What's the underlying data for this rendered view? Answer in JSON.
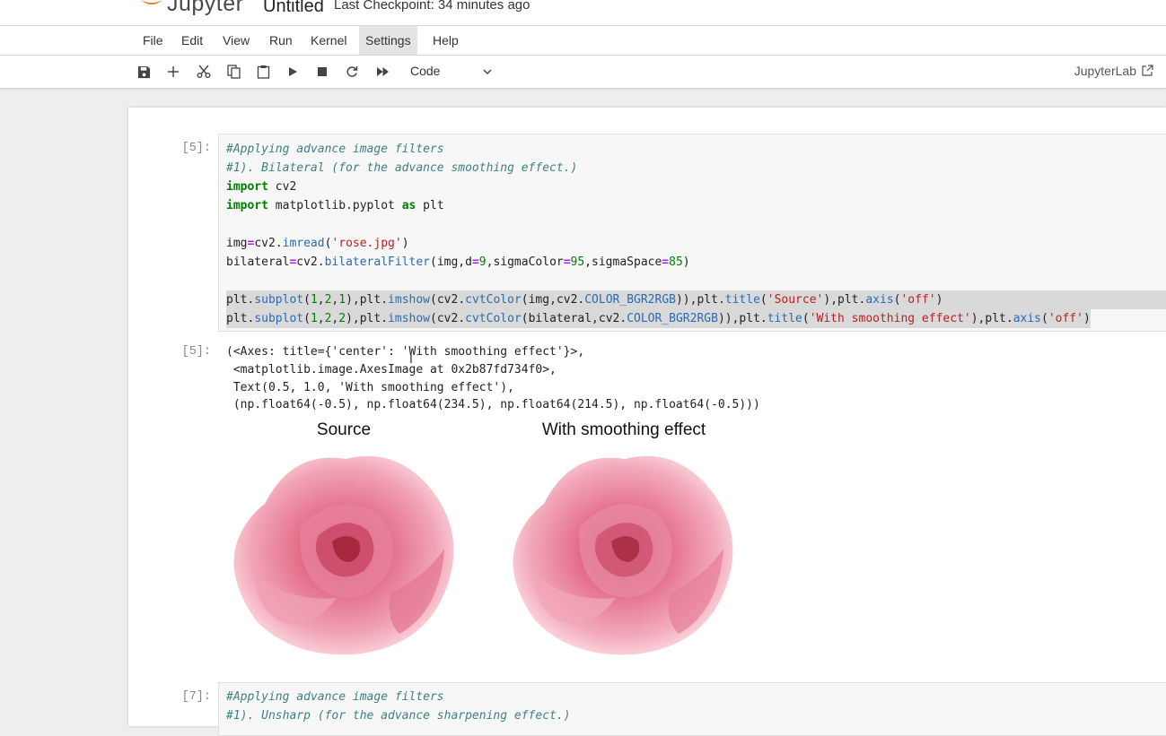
{
  "header": {
    "logo_text": "Jupyter",
    "notebook_title": "Untitled",
    "checkpoint": "Last Checkpoint: 34 minutes ago"
  },
  "menu": [
    "File",
    "Edit",
    "View",
    "Run",
    "Kernel",
    "Settings",
    "Help"
  ],
  "menu_active": "Settings",
  "toolbar": {
    "cell_type": "Code",
    "jupyterlab_link": "JupyterLab",
    "icons": [
      "save-icon",
      "plus-icon",
      "scissors-icon",
      "copy-icon",
      "paste-icon",
      "play-icon",
      "stop-icon",
      "restart-icon",
      "fast-forward-icon",
      "chevron-down-icon",
      "external-link-icon"
    ]
  },
  "cell1": {
    "in_prompt": "[5]:",
    "out_prompt": "[5]:",
    "code": [
      "#Applying advance image filters",
      "#1). Bilateral (for the advance smoothing effect.)",
      "import cv2",
      "import matplotlib.pyplot as plt",
      "",
      "img=cv2.imread('rose.jpg')",
      "bilateral=cv2.bilateralFilter(img,d=9,sigmaColor=95,sigmaSpace=85)",
      "",
      "plt.subplot(1,2,1),plt.imshow(cv2.cvtColor(img,cv2.COLOR_BGR2RGB)),plt.title('Source'),plt.axis('off')",
      "plt.subplot(1,2,2),plt.imshow(cv2.cvtColor(bilateral,cv2.COLOR_BGR2RGB)),plt.title('With smoothing effect'),plt.axis('off')"
    ],
    "output": [
      "(<Axes: title={'center': 'With smoothing effect'}>,",
      " <matplotlib.image.AxesImage at 0x2b87fd734f0>,",
      " Text(0.5, 1.0, 'With smoothing effect'),",
      " (np.float64(-0.5), np.float64(234.5), np.float64(214.5), np.float64(-0.5)))"
    ],
    "figure_titles": [
      "Source",
      "With smoothing effect"
    ]
  },
  "cell2": {
    "in_prompt": "[7]:",
    "code": [
      "#Applying advance image filters",
      "#1). Unsharp (for the advance sharpening effect.)"
    ]
  },
  "colors": {
    "accent_orange": "#f37726",
    "comment": "#408080",
    "keyword": "#008000",
    "string": "#ba2121",
    "function": "#2a6bb3",
    "rose_pink": "#e8879e"
  }
}
